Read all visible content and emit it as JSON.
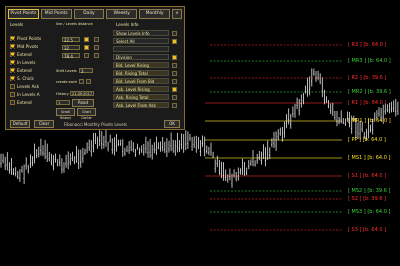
{
  "tabs": [
    "Pivot Points",
    "Mid Points",
    "Daily",
    "Weekly",
    "Monthly"
  ],
  "levels_section": "Levels",
  "line_label": "line / Levels distance",
  "checkboxes": [
    {
      "label": "Pivot Points",
      "on": true
    },
    {
      "label": "Mid Pivots",
      "on": true
    },
    {
      "label": "Extend",
      "on": true
    },
    {
      "label": "In Levels",
      "on": true
    },
    {
      "label": "Extend",
      "on": true
    },
    {
      "label": "S. Chick",
      "on": true
    },
    {
      "label": "Levels Ask",
      "on": false
    },
    {
      "label": "In Levels A",
      "on": false
    },
    {
      "label": "Extend",
      "on": false
    }
  ],
  "values": [
    "22.5",
    "32",
    "78.4",
    "3"
  ],
  "inputs": {
    "shift": "Shift Levels",
    "create": "create each",
    "history": "History",
    "history_date": "21.09.2017",
    "count": "1",
    "read": "Read",
    "scroll": "Scroll History",
    "chart": "Chart Center"
  },
  "info_section": "Levels Info",
  "info_items": [
    "Show Levels Info",
    "Select All",
    "",
    "Division",
    "Bid. Level Rising",
    "Bid. Rising Total",
    "Bid. Level From Bid",
    "Ask. Level Rising",
    "Ask. Rising Total",
    "Ask. Level From Ask"
  ],
  "buttons": {
    "default": "Default",
    "clear": "Clear",
    "ok": "OK"
  },
  "footer_title": "Fibonacci Monthly Pivots Levels",
  "levels": [
    {
      "label": "[ R3 ] [b: 64.0 ]",
      "color": "#ff3030"
    },
    {
      "label": "[ MR3 ] [b: 64.0 ]",
      "color": "#40d040"
    },
    {
      "label": "[ R2 ] [b: 39.6 ]",
      "color": "#ff3030"
    },
    {
      "label": "[ MR2 ] [b: 39.6 ]",
      "color": "#40d040"
    },
    {
      "label": "[ R1 ] [b: 64.0 ]",
      "color": "#ff3030"
    },
    {
      "label": "[ MR1 ] [b: 64.0 ]",
      "color": "#ffe020"
    },
    {
      "label": "[ PP ] [b: 64.0 ]",
      "color": "#ffe020"
    },
    {
      "label": "[ MS1 ] [b: 64.0 ]",
      "color": "#ffe020"
    },
    {
      "label": "[ S1 ] [b: 64.0 ]",
      "color": "#ff3030"
    },
    {
      "label": "[ MS2 ] [b: 39.6 ]",
      "color": "#40d040"
    },
    {
      "label": "[ S2 ] [b: 39.6 ]",
      "color": "#ff3030"
    },
    {
      "label": "[ MS3 ] [b: 64.0 ]",
      "color": "#40d040"
    },
    {
      "label": "[ S3 ] [b: 64.0 ]",
      "color": "#ff3030"
    }
  ]
}
